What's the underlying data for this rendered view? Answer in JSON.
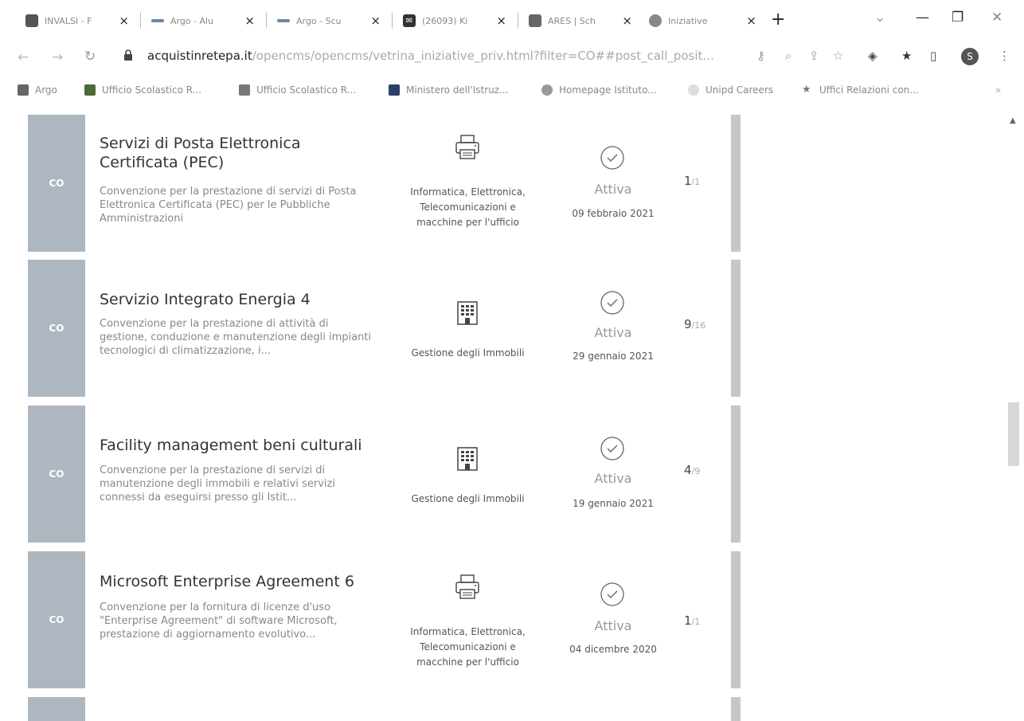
{
  "tabs": [
    {
      "title": "INVALSI - F",
      "fav_color": "#555555"
    },
    {
      "title": "Argo - Alu",
      "fav_color": "#6f86a8"
    },
    {
      "title": "Argo - Scu",
      "fav_color": "#6f86a8"
    },
    {
      "title": "(26093) Ki",
      "fav_color": "#333333"
    },
    {
      "title": "ARES | Sch",
      "fav_color": "#666666"
    },
    {
      "title": "Iniziative",
      "fav_color": "#888888"
    }
  ],
  "address": {
    "host": "acquistinretepa.it",
    "path": "/opencms/opencms/vetrina_iniziative_priv.html?filter=CO##post_call_posit..."
  },
  "profile_initial": "S",
  "bookmarks": [
    {
      "label": "Argo",
      "color": "#666666"
    },
    {
      "label": "Ufficio Scolastico R...",
      "color": "#4a6a3a"
    },
    {
      "label": "Ufficio Scolastico R...",
      "color": "#777777"
    },
    {
      "label": "Ministero dell'Istruz...",
      "color": "#2c3e6a"
    },
    {
      "label": "Homepage Istituto...",
      "color": "#999999"
    },
    {
      "label": "Unipd Careers",
      "color": "#bbbbbb"
    },
    {
      "label": "Uffici Relazioni con...",
      "color": "#999999"
    }
  ],
  "items": [
    {
      "badge": "CO",
      "title": "Servizi di Posta Elettronica Certificata (PEC)",
      "description": "Convenzione per la prestazione di servizi di Posta Elettronica Certificata (PEC) per le Pubbliche Amministrazioni",
      "category": "Informatica, Elettronica, Telecomunicazioni e macchine per l'ufficio",
      "category_icon": "printer-icon",
      "status": "Attiva",
      "date": "09 febbraio 2021",
      "lot_active": "1",
      "lot_total": "/1"
    },
    {
      "badge": "CO",
      "title": "Servizio Integrato Energia 4",
      "description": "Convenzione per la prestazione di attività di gestione, conduzione e manutenzione degli impianti tecnologici di climatizzazione, i...",
      "category": "Gestione degli Immobili",
      "category_icon": "building-icon",
      "status": "Attiva",
      "date": "29 gennaio 2021",
      "lot_active": "9",
      "lot_total": "/16"
    },
    {
      "badge": "CO",
      "title": "Facility management beni culturali",
      "description": "Convenzione per la prestazione di servizi di manutenzione degli immobili e relativi servizi connessi da eseguirsi presso gli Istit...",
      "category": "Gestione degli Immobili",
      "category_icon": "building-icon",
      "status": "Attiva",
      "date": "19 gennaio 2021",
      "lot_active": "4",
      "lot_total": "/9"
    },
    {
      "badge": "CO",
      "title": "Microsoft Enterprise Agreement 6",
      "description": "Convenzione per la fornitura di licenze d'uso \"Enterprise Agreement\" di software Microsoft, prestazione di aggiornamento evolutivo...",
      "category": "Informatica, Elettronica, Telecomunicazioni e macchine per l'ufficio",
      "category_icon": "printer-icon",
      "status": "Attiva",
      "date": "04 dicembre 2020",
      "lot_active": "1",
      "lot_total": "/1"
    }
  ]
}
